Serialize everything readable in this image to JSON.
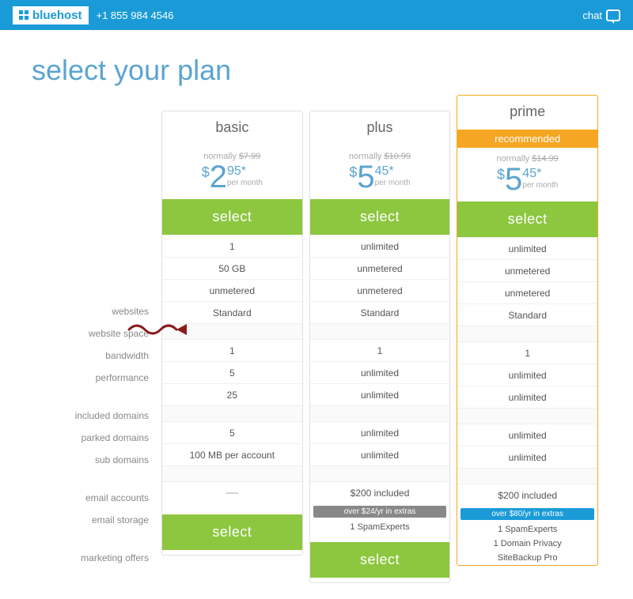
{
  "header": {
    "logo_text": "bluehost",
    "phone": "+1 855 984 4546",
    "chat": "chat"
  },
  "page": {
    "title": "select your plan"
  },
  "plans": [
    {
      "id": "basic",
      "name": "basic",
      "recommended": false,
      "normally_label": "normally",
      "normally_price": "$7.99",
      "price_dollar": "$",
      "price_value": "2",
      "price_cents": "95",
      "price_asterisk": "*",
      "price_per": "per month",
      "select_label": "select",
      "features": {
        "websites": "1",
        "website_space": "50 GB",
        "bandwidth": "unmetered",
        "performance": "Standard",
        "included_domains": "1",
        "parked_domains": "5",
        "sub_domains": "25",
        "email_accounts": "5",
        "email_storage": "100 MB per account",
        "marketing_offers": "—"
      },
      "extras": null,
      "bonus_items": []
    },
    {
      "id": "plus",
      "name": "plus",
      "recommended": false,
      "normally_label": "normally",
      "normally_price": "$10.99",
      "price_dollar": "$",
      "price_value": "5",
      "price_cents": "45",
      "price_asterisk": "*",
      "price_per": "per month",
      "select_label": "select",
      "features": {
        "websites": "unlimited",
        "website_space": "unmetered",
        "bandwidth": "unmetered",
        "performance": "Standard",
        "included_domains": "1",
        "parked_domains": "unlimited",
        "sub_domains": "unlimited",
        "email_accounts": "unlimited",
        "email_storage": "unlimited",
        "marketing_offers": "$200 included"
      },
      "extras_badge": "over $24/yr in extras",
      "extras_badge_type": "gray",
      "bonus_items": [
        "1 SpamExperts"
      ]
    },
    {
      "id": "prime",
      "name": "prime",
      "recommended": true,
      "recommended_label": "recommended",
      "normally_label": "normally",
      "normally_price": "$14.99",
      "price_dollar": "$",
      "price_value": "5",
      "price_cents": "45",
      "price_asterisk": "*",
      "price_per": "per month",
      "select_label": "select",
      "features": {
        "websites": "unlimited",
        "website_space": "unmetered",
        "bandwidth": "unmetered",
        "performance": "Standard",
        "included_domains": "1",
        "parked_domains": "unlimited",
        "sub_domains": "unlimited",
        "email_accounts": "unlimited",
        "email_storage": "unlimited",
        "marketing_offers": "$200 included"
      },
      "extras_badge": "over $80/yr in extras",
      "extras_badge_type": "blue",
      "bonus_items": [
        "1 SpamExperts",
        "1 Domain Privacy",
        "SiteBackup Pro"
      ]
    }
  ],
  "feature_labels": [
    {
      "key": "websites",
      "label": "websites"
    },
    {
      "key": "website_space",
      "label": "website space"
    },
    {
      "key": "bandwidth",
      "label": "bandwidth"
    },
    {
      "key": "performance",
      "label": "performance"
    },
    {
      "key": "spacer1",
      "label": ""
    },
    {
      "key": "included_domains",
      "label": "included domains"
    },
    {
      "key": "parked_domains",
      "label": "parked domains"
    },
    {
      "key": "sub_domains",
      "label": "sub domains"
    },
    {
      "key": "spacer2",
      "label": ""
    },
    {
      "key": "email_accounts",
      "label": "email accounts"
    },
    {
      "key": "email_storage",
      "label": "email storage"
    },
    {
      "key": "spacer3",
      "label": ""
    },
    {
      "key": "marketing_offers",
      "label": "marketing offers"
    }
  ]
}
